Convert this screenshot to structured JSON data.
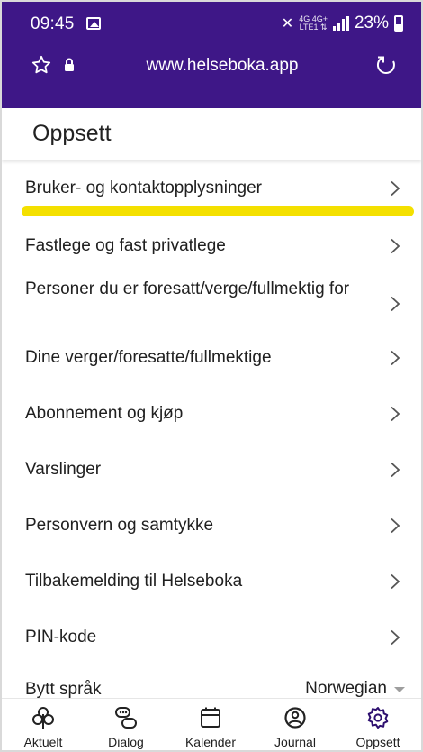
{
  "status_bar": {
    "time": "09:45",
    "network_top": "4G 4G+",
    "network_bottom": "LTE1 ⇅",
    "battery": "23%"
  },
  "browser": {
    "url": "www.helseboka.app"
  },
  "page": {
    "title": "Oppsett"
  },
  "menu": {
    "items": [
      {
        "label": "Bruker- og kontaktopplysninger"
      },
      {
        "label": "Fastlege og fast privatlege"
      },
      {
        "label": "Personer du er foresatt/verge/fullmektig for"
      },
      {
        "label": "Dine verger/foresatte/fullmektige"
      },
      {
        "label": "Abonnement og kjøp"
      },
      {
        "label": "Varslinger"
      },
      {
        "label": "Personvern og samtykke"
      },
      {
        "label": "Tilbakemelding til Helseboka"
      },
      {
        "label": "PIN-kode"
      }
    ],
    "language": {
      "label": "Bytt språk",
      "value": "Norwegian"
    }
  },
  "bottom_nav": [
    {
      "label": "Aktuelt",
      "icon": "aktuelt-icon"
    },
    {
      "label": "Dialog",
      "icon": "dialog-icon"
    },
    {
      "label": "Kalender",
      "icon": "calendar-icon"
    },
    {
      "label": "Journal",
      "icon": "journal-icon"
    },
    {
      "label": "Oppsett",
      "icon": "gear-icon"
    }
  ],
  "colors": {
    "brand": "#3e1787",
    "highlight": "#f4e000",
    "active_nav": "#2e1070"
  }
}
